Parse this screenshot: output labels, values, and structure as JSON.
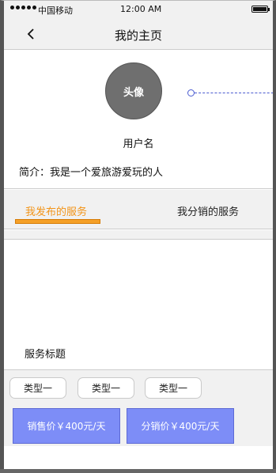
{
  "status_bar": {
    "carrier": "中国移动",
    "time": "12:00 AM",
    "signal_icon": "signal-dots-icon",
    "battery_icon": "battery-icon"
  },
  "nav": {
    "back_icon": "chevron-left-icon",
    "title": "我的主页"
  },
  "profile": {
    "avatar_label": "头像",
    "username": "用户名",
    "bio": "简介：我是一个爱旅游爱玩的人"
  },
  "tabs": [
    {
      "label": "我发布的服务",
      "active": true
    },
    {
      "label": "我分销的服务",
      "active": false
    }
  ],
  "service": {
    "title": "服务标题",
    "types": [
      "类型一",
      "类型一",
      "类型一"
    ],
    "sale_price": "销售价￥400元/天",
    "distribution_price": "分销价￥400元/天"
  },
  "colors": {
    "accent_orange": "#f29418",
    "button_blue": "#7d8df7",
    "avatar_gray": "#6f6f6f",
    "bar_background": "#f1f1f1",
    "annotation_blue": "#4a5bd0"
  }
}
